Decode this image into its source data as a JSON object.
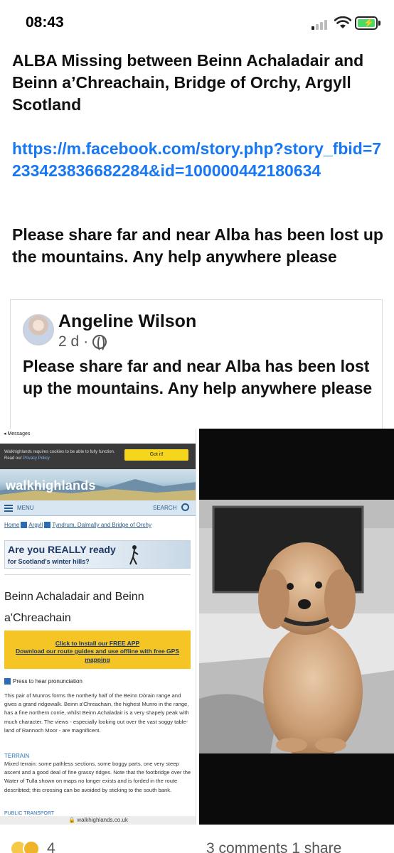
{
  "status_bar": {
    "time": "08:43"
  },
  "post": {
    "title": "ALBA Missing between Beinn Achaladair and Beinn a’Chreachain, Bridge of Orchy, Argyll Scotland",
    "link": "https://m.facebook.com/story.php?story_fbid=7233423836682284&id=100000442180634",
    "message": "Please share far and near Alba has been lost up the mountains. Any help anywhere please"
  },
  "shared_post": {
    "author": "Angeline Wilson",
    "time_ago": "2 d",
    "separator": "·",
    "message": "Please share far and near Alba has been lost up the mountains. Any help anywhere please"
  },
  "screenshot": {
    "back_label": "◂ Messages",
    "cookie_text": "Walkhighlands requires cookies to be able to fully function. Read our",
    "cookie_link": "Privacy Policy",
    "got_it": "Got it!",
    "logo": "walkhighlands",
    "menu_label": "MENU",
    "search_label": "SEARCH",
    "crumb_1": "Home",
    "crumb_2": "Argyll",
    "crumb_3": "Tyndrum, Dalmally and Bridge of Orchy",
    "ad_line_1": "Are you REALLY ready",
    "ad_line_2": "for Scotland's winter hills?",
    "page_title": "Beinn Achaladair and Beinn a'Chreachain",
    "app_line_1": "Click to Install our FREE APP",
    "app_line_2": "Download our route guides and use offline with free GPS mapping",
    "pronunciation": "Press to hear pronunciation",
    "description": "This pair of Munros forms the northerly half of the Beinn Dòrain range and gives a grand ridgewalk. Beinn a'Chreachain, the highest Munro in the range, has a fine northern corrie, whilst Beinn Achaladair is a very shapely peak with much character. The views - especially looking out over the vast soggy table-land of Rannoch Moor - are magnificent.",
    "terrain_heading": "TERRAIN",
    "terrain_text": "Mixed terrain: some pathless sections, some boggy parts, one very steep ascent and a good deal of fine grassy ridges. Note that the footbridge over the Water of Tulla shown on maps no longer exists and is forded in the route describted; this crossing can be avoided by sticking to the south bank.",
    "public_transport": "PUBLIC TRANSPORT",
    "url": "🔒 walkhighlands.co.uk"
  },
  "footer": {
    "reaction_count": "4",
    "comments_shares": "3 comments  1 share"
  },
  "colors": {
    "link": "#1877f2",
    "battery": "#4cd964",
    "app_banner": "#f5c526"
  }
}
